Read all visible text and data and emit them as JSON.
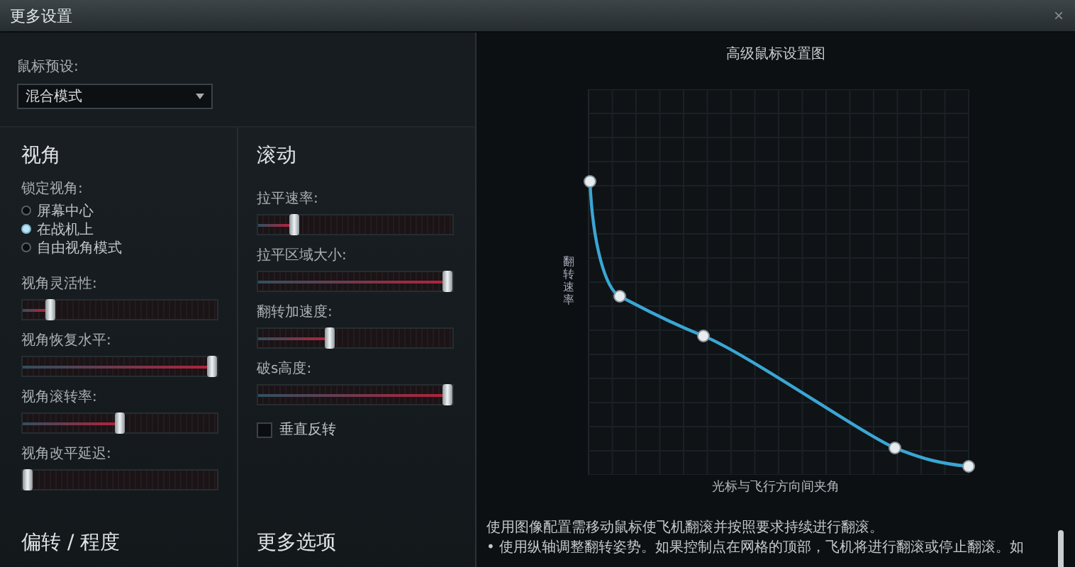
{
  "window": {
    "title": "更多设置",
    "close": "×"
  },
  "preset": {
    "label": "鼠标预设:",
    "value": "混合模式"
  },
  "view": {
    "title": "视角",
    "lock_label": "锁定视角:",
    "options": [
      {
        "label": "屏幕中心",
        "selected": false
      },
      {
        "label": "在战机上",
        "selected": true
      },
      {
        "label": "自由视角模式",
        "selected": false
      }
    ],
    "sliders": [
      {
        "label": "视角灵活性:",
        "level": 0.12
      },
      {
        "label": "视角恢复水平:",
        "level": 1
      },
      {
        "label": "视角滚转率:",
        "level": 0.5
      },
      {
        "label": "视角改平延迟:",
        "level": 0
      }
    ]
  },
  "scroll": {
    "title": "滚动",
    "sliders": [
      {
        "label": "拉平速率:",
        "level": 0.17
      },
      {
        "label": "拉平区域大小:",
        "level": 1
      },
      {
        "label": "翻转加速度:",
        "level": 0.36
      },
      {
        "label": "破s高度:",
        "level": 1
      }
    ],
    "checkbox": {
      "label": "垂直反转",
      "checked": false
    }
  },
  "sections": [
    "偏转 / 程度",
    "更多选项"
  ],
  "chart": {
    "title": "高级鼠标设置图",
    "xlabel": "光标与飞行方向间夹角",
    "ylabel": "翻转速率"
  },
  "description": "使用图像配置需移动鼠标使飞机翻滚并按照要求持续进行翻滚。\n• 使用纵轴调整翻转姿势。如果控制点在网格的顶部，飞机将进行翻滚或停止翻滚。如"
}
